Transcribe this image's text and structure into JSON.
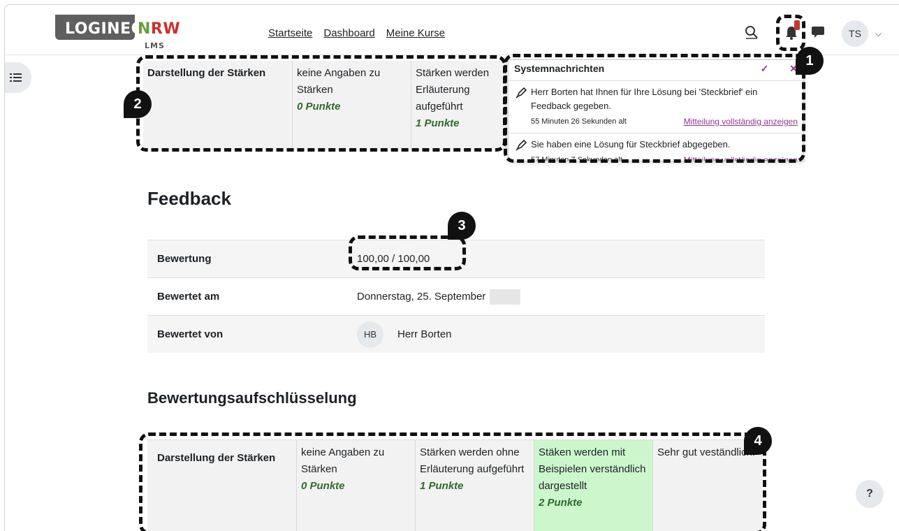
{
  "logo": {
    "part1": "LOGINEO",
    "part2a": "N",
    "part2b": "RW",
    "sub": "LMS"
  },
  "nav": {
    "home": "Startseite",
    "dashboard": "Dashboard",
    "courses": "Meine Kurse"
  },
  "user": {
    "initials": "TS"
  },
  "rubric_top": {
    "criterion": "Darstellung der Stärken",
    "level1_text": "keine Angaben zu Stärken",
    "level1_points": "0 Punkte",
    "level2_text": "Stärken werden Erläuterung aufgeführt",
    "level2_points": "1 Punkte"
  },
  "notifications": {
    "title": "Systemnachrichten",
    "items": [
      {
        "text": "Herr Borten hat Ihnen für Ihre Lösung bei 'Steckbrief' ein Feedback gegeben.",
        "time": "55 Minuten 26 Sekunden alt",
        "link": "Mitteilung vollständig anzeigen"
      },
      {
        "text": "Sie haben eine Lösung für Steckbrief abgegeben.",
        "time": "57 Minuten 7 Sekunden alt",
        "link": "Mitteilung vollständig anzeigen"
      }
    ]
  },
  "feedback": {
    "heading": "Feedback",
    "rows": [
      {
        "label": "Bewertung",
        "value": "100,00 / 100,00"
      },
      {
        "label": "Bewertet am",
        "value": "Donnerstag, 25. September"
      },
      {
        "label": "Bewertet von",
        "value": "Herr Borten",
        "initials": "HB"
      }
    ]
  },
  "breakdown": {
    "heading": "Bewertungsaufschlüsselung",
    "criterion": "Darstellung der Stärken",
    "levels": [
      {
        "text": "keine Angaben zu Stärken",
        "points": "0 Punkte"
      },
      {
        "text": "Stärken werden ohne Erläuterung aufgeführt",
        "points": "1 Punkte"
      },
      {
        "text": "Stäken werden mit Beispielen verständlich dargestellt",
        "points": "2 Punkte"
      }
    ],
    "remark": "Sehr gut veständlich."
  },
  "markers": [
    "1",
    "2",
    "3",
    "4"
  ],
  "help": "?",
  "colors": {
    "selected_level": "#ccf7cc",
    "points": "#2e6b2e",
    "link": "#8e3a8e",
    "badge": "#c0392b"
  }
}
